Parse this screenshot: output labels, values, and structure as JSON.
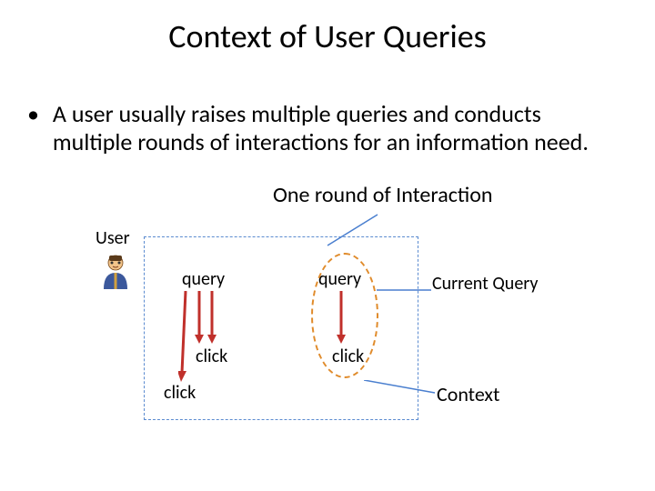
{
  "title": "Context of User Queries",
  "bullet": "A user usually raises multiple queries and conducts multiple rounds of interactions for an information need.",
  "round_label": "One round of Interaction",
  "user_label": "User",
  "q1": "query",
  "q2": "query",
  "c1": "click",
  "c2": "click",
  "c3": "click",
  "current_query_label": "Current Query",
  "context_label": "Context"
}
